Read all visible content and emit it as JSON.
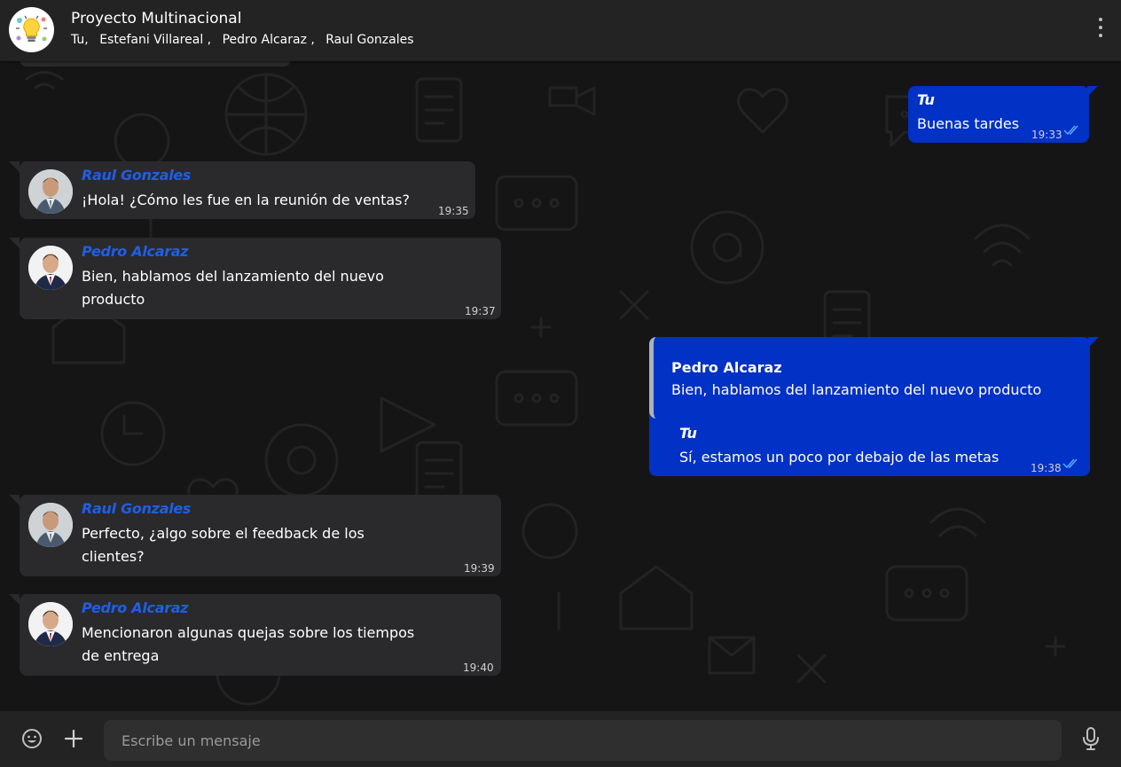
{
  "header": {
    "title": "Proyecto Multinacional",
    "members": [
      "Tu,",
      "Estefani Villareal ,",
      "Pedro Alcaraz ,",
      "Raul Gonzales"
    ],
    "avatar_icon": "lightbulb-icon",
    "menu_icon": "more-vertical-icon"
  },
  "messages": [
    {
      "sender": "Tu",
      "text": "Buenas tardes",
      "time": "19:33",
      "status": "read-ticks-icon"
    },
    {
      "sender": "Raul Gonzales",
      "text": "¡Hola! ¿Cómo les fue en la reunión de ventas?",
      "time": "19:35"
    },
    {
      "sender": "Pedro Alcaraz",
      "text_lines": [
        "Bien, hablamos del lanzamiento del nuevo",
        "producto"
      ],
      "time": "19:37"
    },
    {
      "sender": "Tu",
      "reply_to": {
        "name": "Pedro Alcaraz",
        "text": "Bien, hablamos del lanzamiento del nuevo producto"
      },
      "text": "Sí, estamos un poco por debajo de las metas",
      "time": "19:38",
      "status": "read-ticks-icon"
    },
    {
      "sender": "Raul Gonzales",
      "text_lines": [
        "Perfecto, ¿algo sobre el feedback de los",
        "clientes?"
      ],
      "time": "19:39"
    },
    {
      "sender": "Pedro Alcaraz",
      "text_lines": [
        "Mencionaron algunas quejas sobre los tiempos",
        "de entrega"
      ],
      "time": "19:40"
    }
  ],
  "composer": {
    "placeholder": "Escribe un mensaje",
    "emoji_icon": "emoji-icon",
    "attach_icon": "plus-icon",
    "mic_icon": "microphone-icon"
  },
  "colors": {
    "outgoing_bubble": "#0231c5",
    "incoming_bubble": "#2a2a2c",
    "sender_name": "#1f5ee6",
    "background": "#151515",
    "bars": "#232323"
  }
}
